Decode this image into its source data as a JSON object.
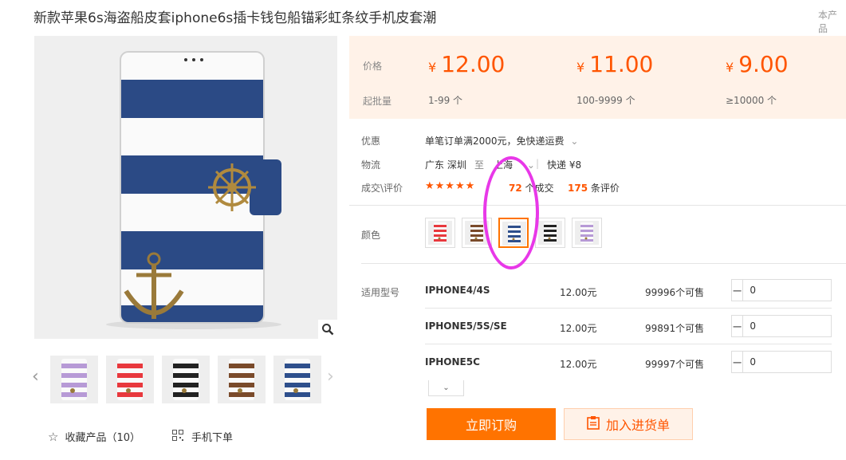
{
  "product": {
    "title": "新款苹果6s海盗船皮套iphone6s插卡钱包船锚彩虹条纹手机皮套潮",
    "side_tab": "本产品"
  },
  "gallery": {
    "prev_icon": "‹",
    "next_icon": "›",
    "thumbnails": [
      {
        "color": "purple-stripes",
        "hex": "#b79ad6"
      },
      {
        "color": "red-stripes",
        "hex": "#e8383d"
      },
      {
        "color": "black-stripes",
        "hex": "#222222"
      },
      {
        "color": "brown-stripes",
        "hex": "#7a4a2a"
      },
      {
        "color": "navy-stripes",
        "hex": "#2e4f8c"
      }
    ]
  },
  "actions": {
    "favorite_label": "收藏产品（10）",
    "mobile_label": "手机下单"
  },
  "pricing": {
    "price_label": "价格",
    "moq_label": "起批量",
    "currency": "¥",
    "tiers": [
      {
        "price": "12.00",
        "range": "1-99 个"
      },
      {
        "price": "11.00",
        "range": "100-9999 个"
      },
      {
        "price": "9.00",
        "range": "≥10000 个"
      }
    ]
  },
  "info": {
    "promo_label": "优惠",
    "promo_text": "单笔订单满2000元，免快递运费",
    "logistics_label": "物流",
    "origin": "广东 深圳",
    "to": "至",
    "destination": "上海",
    "shipping": "快递 ¥8",
    "deals_label": "成交\\评价",
    "stars": "★★★★★",
    "deals_count": "72",
    "deals_suffix": "个成交",
    "reviews_count": "175",
    "reviews_suffix": "条评价"
  },
  "colors": {
    "label": "颜色",
    "swatches": [
      {
        "name": "red",
        "hex": "#e8383d"
      },
      {
        "name": "brown",
        "hex": "#7a4a2a"
      },
      {
        "name": "navy",
        "hex": "#2e4f8c"
      },
      {
        "name": "black",
        "hex": "#222222"
      },
      {
        "name": "purple",
        "hex": "#b79ad6"
      }
    ],
    "selected_index": 2
  },
  "models": {
    "label": "适用型号",
    "rows": [
      {
        "model": "IPHONE4/4S",
        "price": "12.00元",
        "stock": "99996个可售",
        "qty": "0"
      },
      {
        "model": "IPHONE5/5S/SE",
        "price": "12.00元",
        "stock": "99891个可售",
        "qty": "0"
      },
      {
        "model": "IPHONE5C",
        "price": "12.00元",
        "stock": "99997个可售",
        "qty": "0"
      }
    ]
  },
  "buttons": {
    "buy_now": "立即订购",
    "add_to_cart": "加入进货单"
  },
  "theme": {
    "accent": "#ff5500",
    "button_orange": "#ff7300",
    "price_bg": "#fff2e8",
    "annotation": "#e838e8"
  }
}
